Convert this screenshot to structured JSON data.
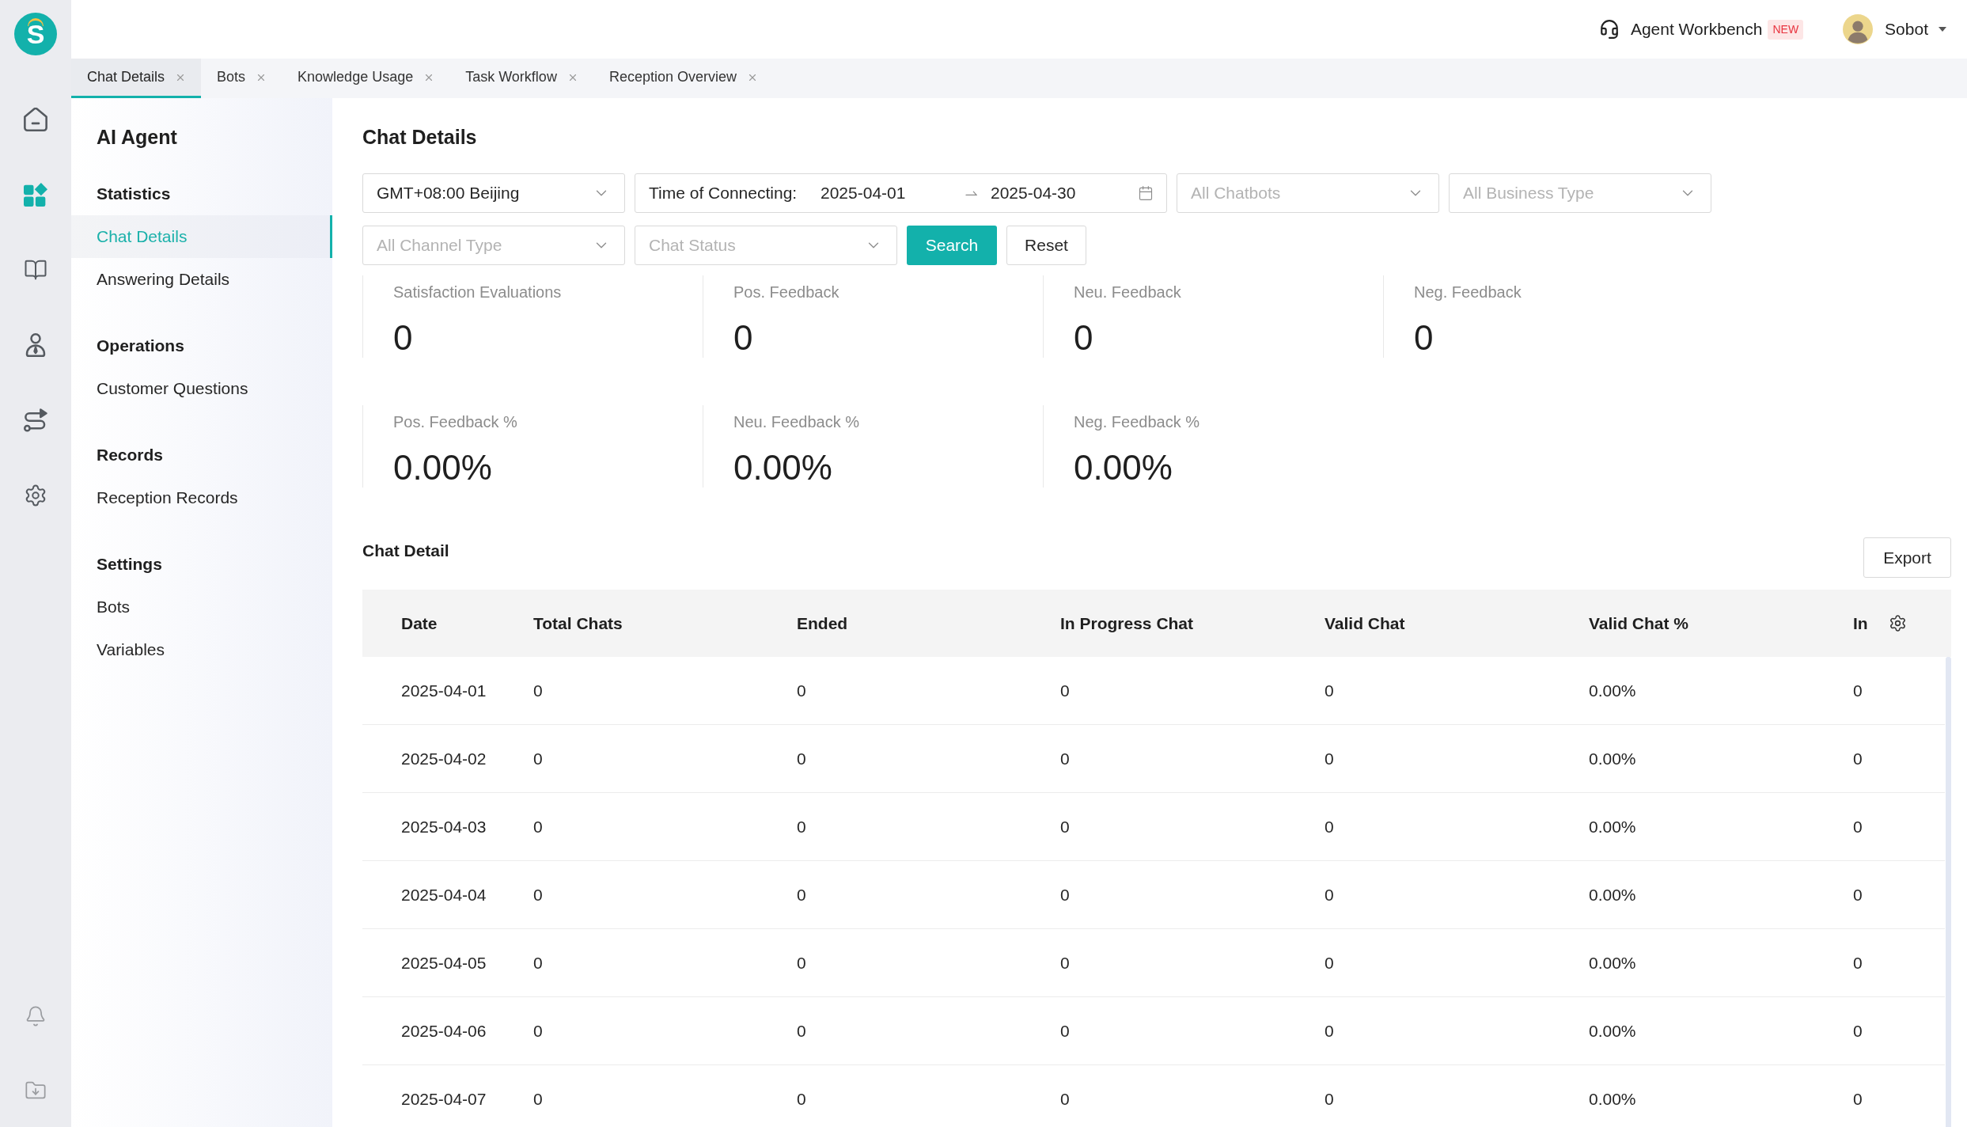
{
  "logo": {
    "letter": "S"
  },
  "rail": [
    {
      "selected": false
    },
    {
      "selected": true
    },
    {
      "selected": false
    },
    {
      "selected": false
    },
    {
      "selected": false
    },
    {
      "selected": false
    }
  ],
  "header": {
    "workbench": {
      "label": "Agent Workbench",
      "badge": "NEW"
    },
    "user": {
      "name": "Sobot"
    }
  },
  "tabs": [
    {
      "label": "Chat Details",
      "selected": true
    },
    {
      "label": "Bots",
      "selected": false
    },
    {
      "label": "Knowledge Usage",
      "selected": false
    },
    {
      "label": "Task Workflow",
      "selected": false
    },
    {
      "label": "Reception Overview",
      "selected": false
    }
  ],
  "sidebar": {
    "title": "AI Agent",
    "groups": [
      {
        "heading": "Statistics",
        "items": [
          {
            "label": "Chat Details",
            "selected": true
          },
          {
            "label": "Answering Details",
            "selected": false
          }
        ]
      },
      {
        "heading": "Operations",
        "items": [
          {
            "label": "Customer Questions",
            "selected": false
          }
        ]
      },
      {
        "heading": "Records",
        "items": [
          {
            "label": "Reception Records",
            "selected": false
          }
        ]
      },
      {
        "heading": "Settings",
        "items": [
          {
            "label": "Bots",
            "selected": false
          },
          {
            "label": "Variables",
            "selected": false
          }
        ]
      }
    ]
  },
  "page": {
    "title": "Chat Details"
  },
  "filters": [
    {
      "kind": "select",
      "value": "GMT+08:00 Beijing"
    },
    {
      "kind": "date_range",
      "label": "Time of Connecting:",
      "start": "2025-04-01",
      "end": "2025-04-30"
    },
    {
      "kind": "select",
      "placeholder": "All Chatbots"
    },
    {
      "kind": "select",
      "placeholder": "All Business Type"
    },
    {
      "kind": "select",
      "placeholder": "All Channel Type"
    },
    {
      "kind": "select",
      "placeholder": "Chat Status"
    },
    {
      "kind": "primary",
      "label": "Search"
    },
    {
      "kind": "default",
      "label": "Reset"
    }
  ],
  "stats": [
    {
      "cards": [
        {
          "label": "Satisfaction Evaluations",
          "value": "0"
        },
        {
          "label": "Pos. Feedback",
          "value": "0"
        },
        {
          "label": "Neu. Feedback",
          "value": "0"
        },
        {
          "label": "Neg. Feedback",
          "value": "0"
        }
      ]
    },
    {
      "cards": [
        {
          "label": "Pos. Feedback %",
          "value": "0.00%"
        },
        {
          "label": "Neu. Feedback %",
          "value": "0.00%"
        },
        {
          "label": "Neg. Feedback %",
          "value": "0.00%"
        }
      ]
    }
  ],
  "chat_detail": {
    "title": "Chat Detail",
    "export": "Export",
    "table": {
      "columns": [
        "Date",
        "Total Chats",
        "Ended",
        "In Progress Chat",
        "Valid Chat",
        "Valid Chat %",
        "In"
      ],
      "rows": [
        [
          "2025-04-01",
          "0",
          "0",
          "0",
          "0",
          "0.00%",
          "0"
        ],
        [
          "2025-04-02",
          "0",
          "0",
          "0",
          "0",
          "0.00%",
          "0"
        ],
        [
          "2025-04-03",
          "0",
          "0",
          "0",
          "0",
          "0.00%",
          "0"
        ],
        [
          "2025-04-04",
          "0",
          "0",
          "0",
          "0",
          "0.00%",
          "0"
        ],
        [
          "2025-04-05",
          "0",
          "0",
          "0",
          "0",
          "0.00%",
          "0"
        ],
        [
          "2025-04-06",
          "0",
          "0",
          "0",
          "0",
          "0.00%",
          "0"
        ],
        [
          "2025-04-07",
          "0",
          "0",
          "0",
          "0",
          "0.00%",
          "0"
        ]
      ]
    }
  }
}
